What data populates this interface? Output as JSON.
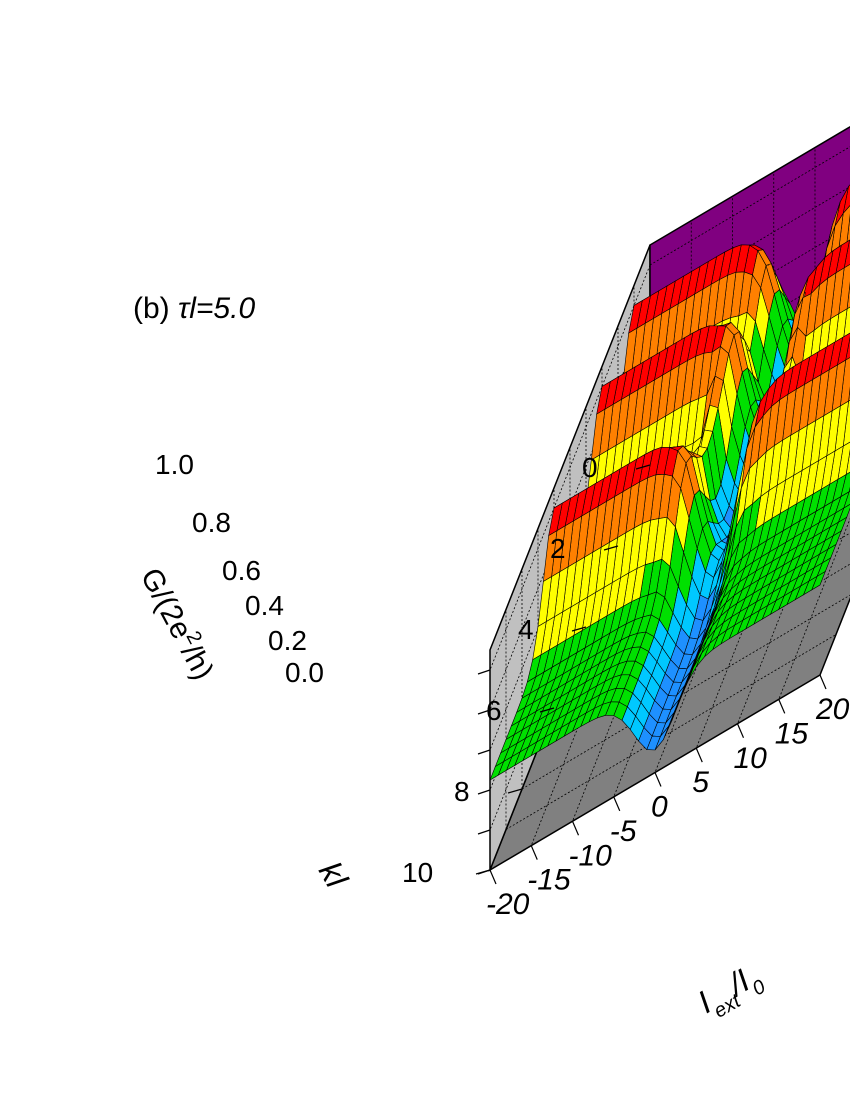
{
  "chart_data": {
    "type": "surface3d",
    "panel_label": "(b)",
    "parameter_symbol": "τl",
    "parameter_value": "=5.0",
    "z_axis": {
      "label_main": "G/(2e",
      "label_sup": "2",
      "label_tail": "/h)",
      "ticks": [
        "0.0",
        "0.2",
        "0.4",
        "0.6",
        "0.8",
        "1.0"
      ],
      "range": [
        0.0,
        1.0
      ]
    },
    "y_axis": {
      "label": "kl",
      "ticks": [
        "0",
        "2",
        "4",
        "6",
        "8",
        "10"
      ],
      "range": [
        0,
        10
      ]
    },
    "x_axis": {
      "label_main": "I",
      "label_sub": "ext",
      "label_sep": "/I",
      "label_sub2": "0",
      "ticks": [
        "-20",
        "-15",
        "-10",
        "-5",
        "0",
        "5",
        "10",
        "15",
        "20"
      ],
      "range": [
        -20,
        20
      ]
    },
    "color_bands": [
      "#1e90ff",
      "#00c8ff",
      "#00e000",
      "#ffff00",
      "#ff8000",
      "#ff0000"
    ],
    "wall_colors": {
      "left": "#c0c0c0",
      "right": "#800080",
      "floor": "#808080"
    },
    "ridges_at_kl": [
      1,
      3,
      6
    ],
    "grid": true
  }
}
